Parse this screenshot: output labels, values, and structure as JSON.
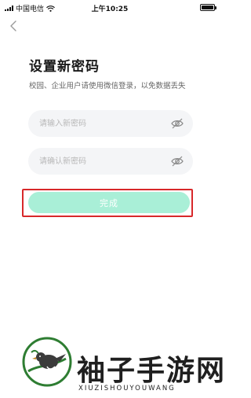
{
  "status_bar": {
    "carrier": "中国电信",
    "time": "上午10:25",
    "wifi_icon": "wifi-icon",
    "battery_level": 1.0
  },
  "nav": {
    "back_icon": "chevron-left-icon"
  },
  "page": {
    "title": "设置新密码",
    "subtitle": "校园、企业用户请使用微信登录，以免数据丢失"
  },
  "form": {
    "new_password": {
      "placeholder": "请输入新密码",
      "value": "",
      "toggle_icon": "eye-off-icon"
    },
    "confirm_password": {
      "placeholder": "请确认新密码",
      "value": "",
      "toggle_icon": "eye-off-icon"
    },
    "submit_label": "完成"
  },
  "watermark": {
    "text": "袖子手游网",
    "subtext": "XIUZISHOUYOUWANG",
    "colors": {
      "logo_ring": "#2e7d32",
      "text": "#1f1f1f"
    }
  },
  "colors": {
    "button_bg": "#a9efd7",
    "highlight_border": "#d8282a",
    "field_bg": "#f4f5f7"
  }
}
